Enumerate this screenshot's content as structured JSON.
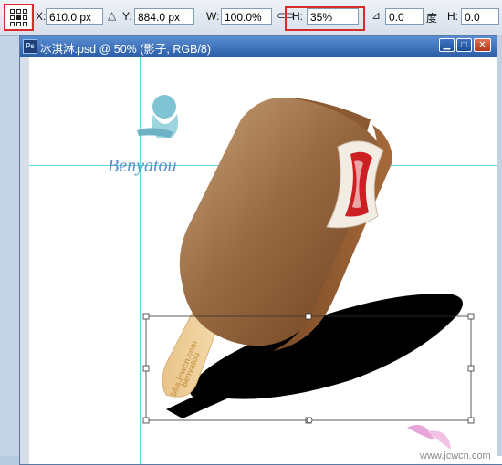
{
  "options_bar": {
    "x_label": "X:",
    "x_value": "610.0 px",
    "y_label": "Y:",
    "y_value": "884.0 px",
    "w_label": "W:",
    "w_value": "100.0%",
    "h_label": "H:",
    "h_value": "35%",
    "angle_value": "0.0",
    "angle_unit": "度",
    "skew_h_label": "H:",
    "skew_h_value": "0.0",
    "highlight_color": "#d92b2b"
  },
  "document": {
    "title": "冰淇淋.psd @ 50% (影子, RGB/8)",
    "app_icon_text": "Ps",
    "minimize_glyph": "▁",
    "maximize_glyph": "□",
    "close_glyph": "✕"
  },
  "canvas": {
    "logo_text": "Benyatou",
    "stick_text": "bbs.jcwcn.com",
    "stick_text2": "benyatou",
    "footer_watermark": "www.jcwcn.com",
    "guide_color": "#5fd6e6",
    "chocolate_color": "#8b5a32",
    "icecream_filling_color": "#cc1f24"
  }
}
